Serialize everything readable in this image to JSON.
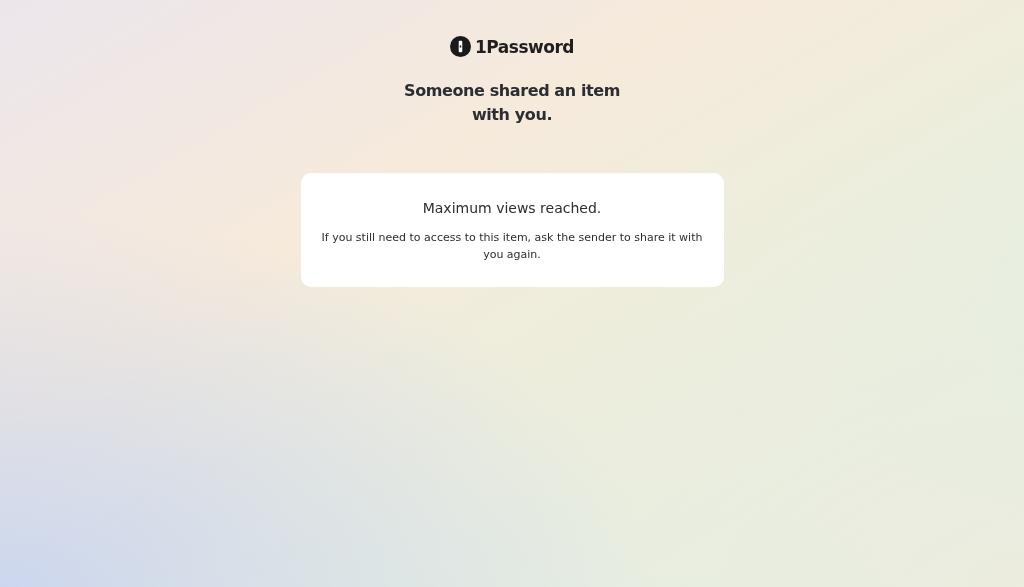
{
  "logo": {
    "text": "1Password"
  },
  "heading": "Someone shared an item with you.",
  "card": {
    "title": "Maximum views reached.",
    "message": "If you still need to access to this item, ask the sender to share it with you again."
  }
}
